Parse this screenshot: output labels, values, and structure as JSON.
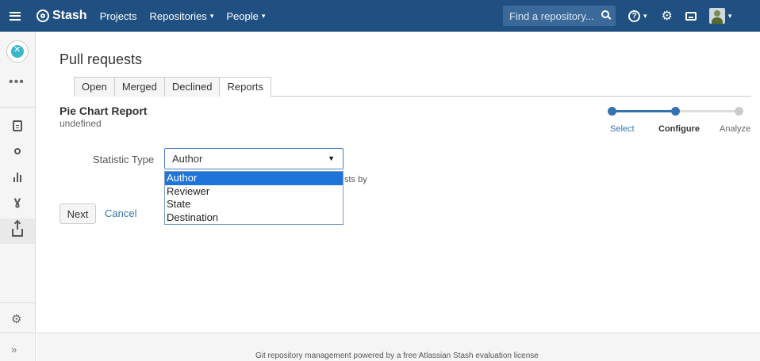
{
  "topbar": {
    "menu_icon": "hamburger-menu-icon",
    "brand": "Stash",
    "nav": [
      "Projects",
      "Repositories",
      "People"
    ],
    "search_placeholder": "Find a repository...",
    "help_icon": "?"
  },
  "sidebar": {
    "more": "•••",
    "expand": "»"
  },
  "page": {
    "title": "Pull requests",
    "tabs": [
      "Open",
      "Merged",
      "Declined",
      "Reports"
    ],
    "active_tab": "Reports"
  },
  "report": {
    "title": "Pie Chart Report",
    "subtitle": "undefined"
  },
  "tracker": {
    "steps": [
      "Select",
      "Configure",
      "Analyze"
    ],
    "completed_color": "#3572b0",
    "pending_color": "#cccccc"
  },
  "form": {
    "statistic_label": "Statistic Type",
    "selected_value": "Author",
    "options": [
      "Author",
      "Reviewer",
      "State",
      "Destination"
    ],
    "help_text_visible": "sts by",
    "next_label": "Next",
    "cancel_label": "Cancel"
  },
  "footer": {
    "text": "Git repository management powered by a free Atlassian Stash evaluation license"
  },
  "colors": {
    "header": "#205081",
    "accent": "#3572b0",
    "selected_option": "#1e74d9"
  }
}
